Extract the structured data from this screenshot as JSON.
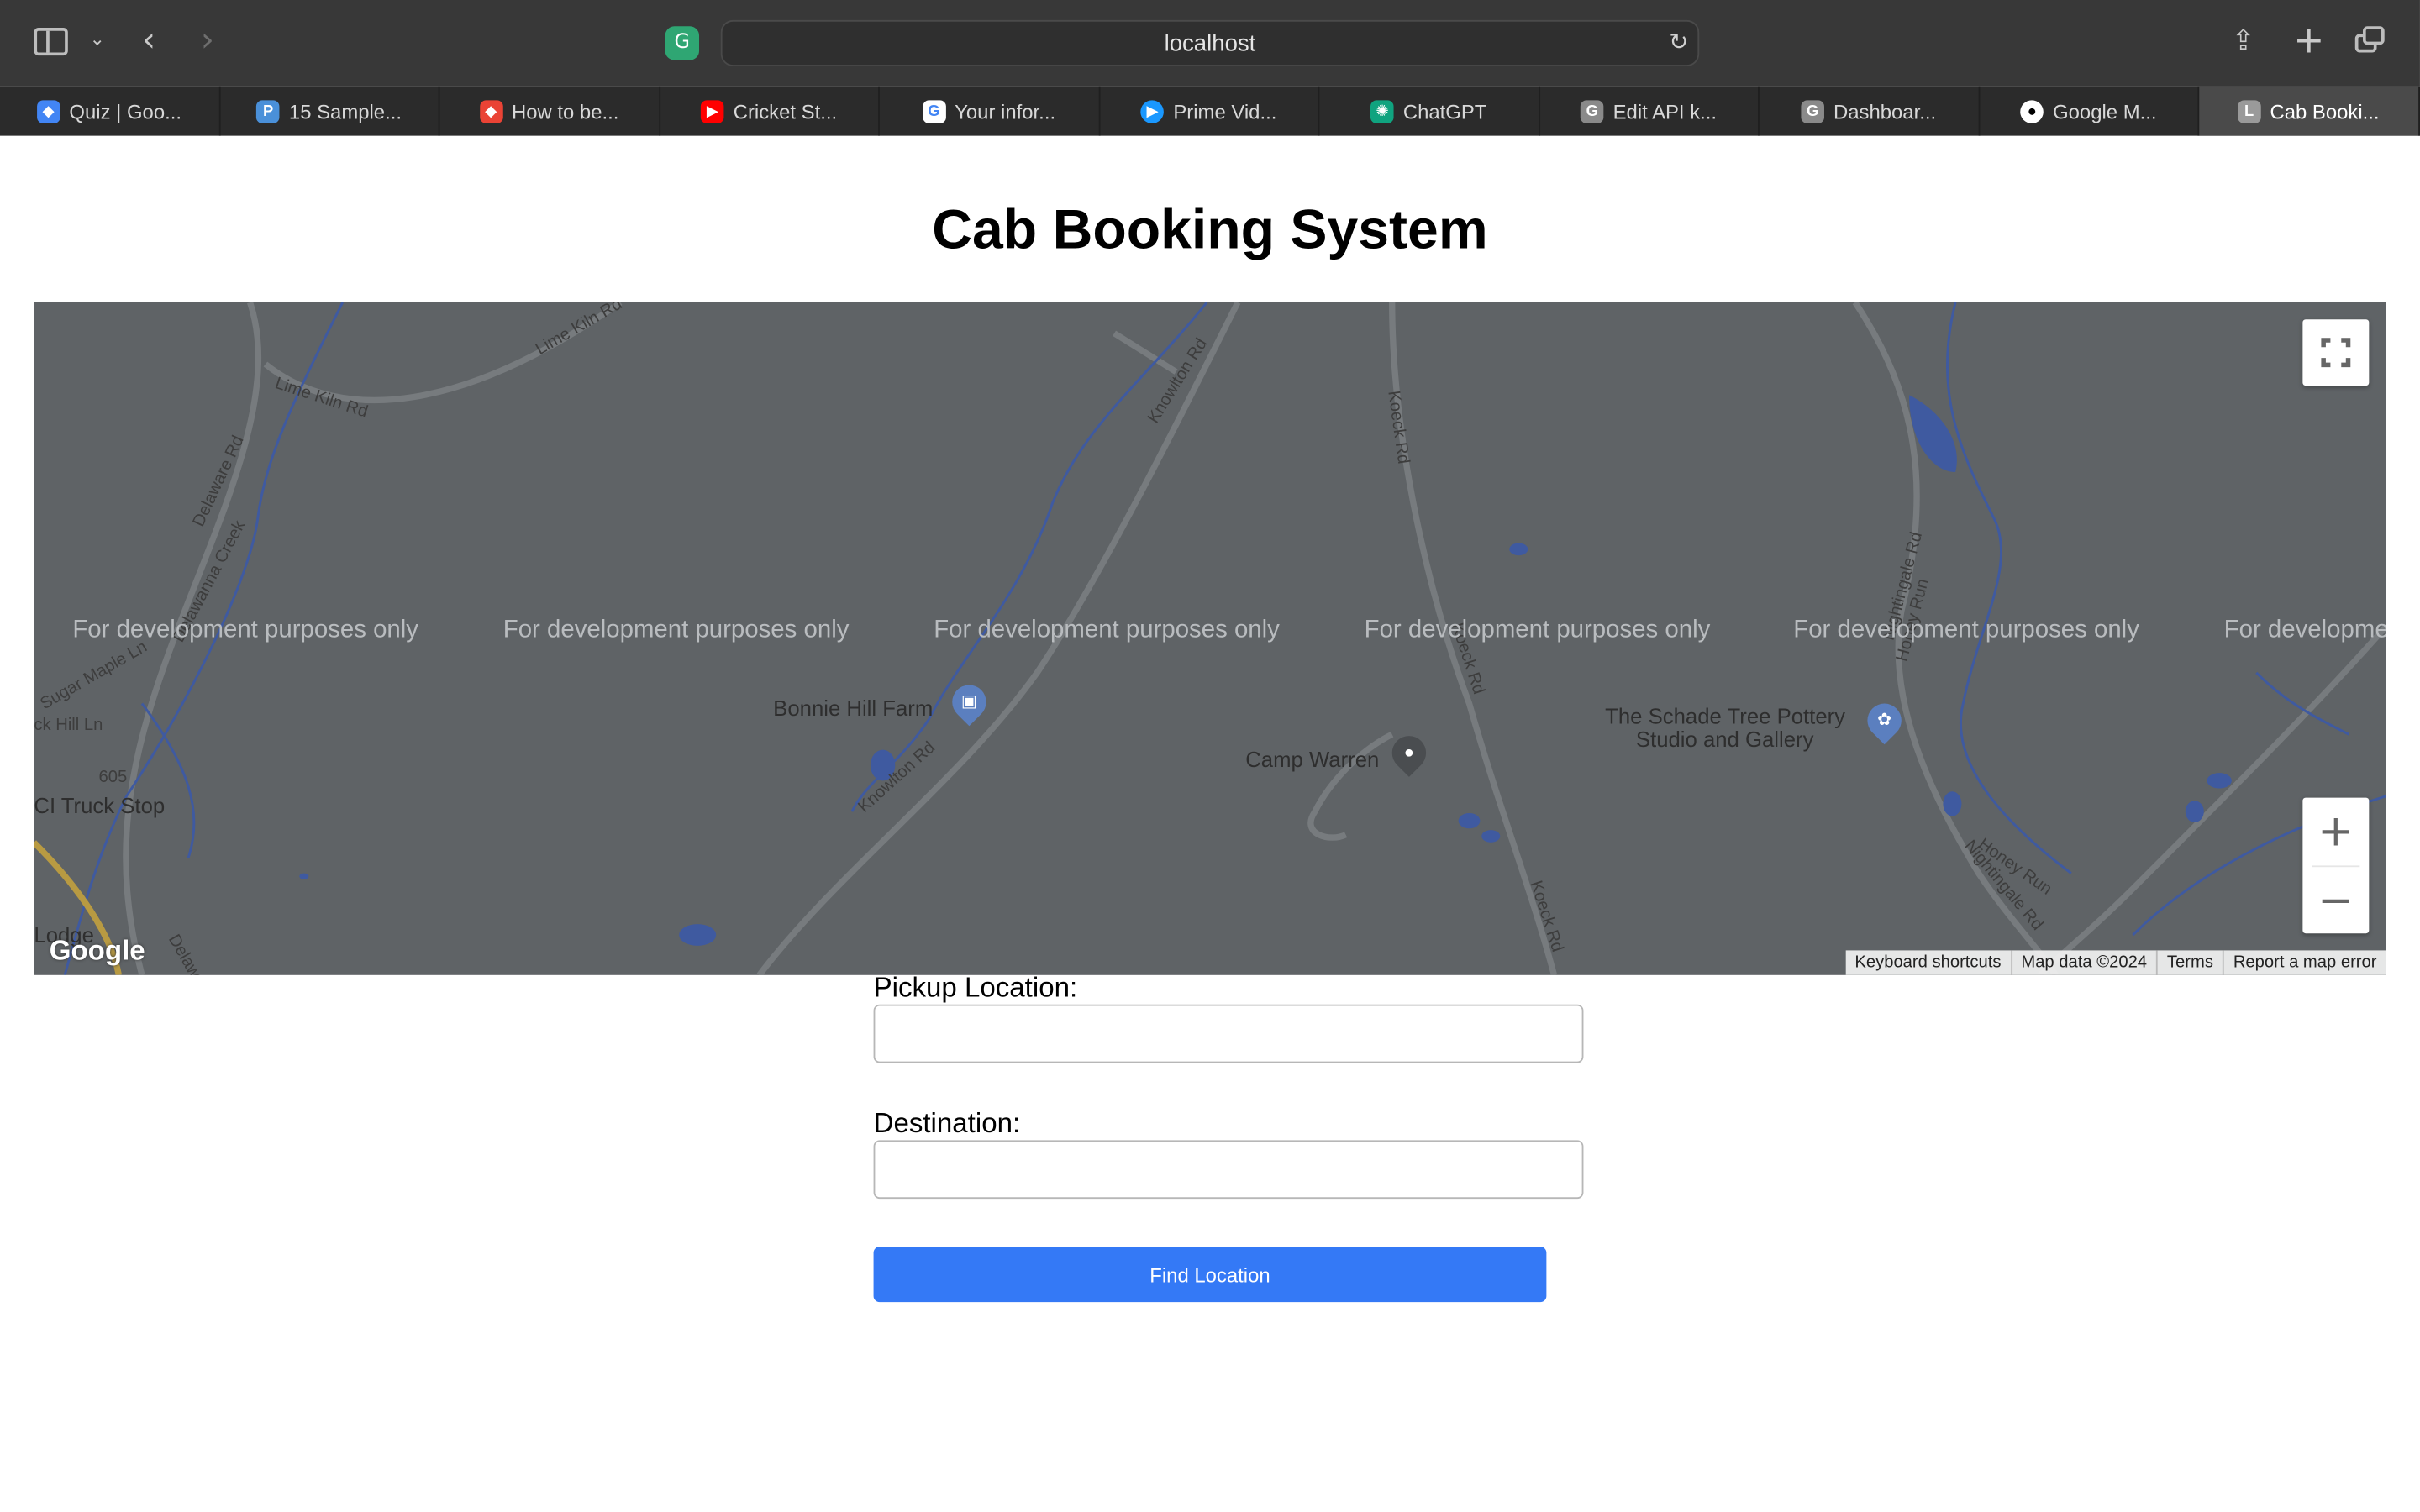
{
  "browser": {
    "address": "localhost",
    "tabs": [
      {
        "label": "Quiz | Goo...",
        "icon": "google-cloud-icon",
        "color": "#4285f4",
        "active": false
      },
      {
        "label": "15 Sample...",
        "icon": "pp-icon",
        "color": "#4a90d9",
        "active": false
      },
      {
        "label": "How to be...",
        "icon": "google-cloud-icon",
        "color": "#ea4335",
        "active": false
      },
      {
        "label": "Cricket St...",
        "icon": "youtube-icon",
        "color": "#ff0000",
        "active": false
      },
      {
        "label": "Your infor...",
        "icon": "google-icon",
        "color": "#ffffff",
        "active": false
      },
      {
        "label": "Prime Vid...",
        "icon": "prime-video-icon",
        "color": "#1a98ff",
        "active": false
      },
      {
        "label": "ChatGPT",
        "icon": "chatgpt-icon",
        "color": "#10a37f",
        "active": false
      },
      {
        "label": "Edit API k...",
        "icon": "g-letter-icon",
        "color": "#8a8a8a",
        "active": false
      },
      {
        "label": "Dashboar...",
        "icon": "g-letter-icon",
        "color": "#8a8a8a",
        "active": false
      },
      {
        "label": "Google M...",
        "icon": "github-icon",
        "color": "#ffffff",
        "active": false
      },
      {
        "label": "Cab Booki...",
        "icon": "l-letter-icon",
        "color": "#9a9a9a",
        "active": true
      }
    ]
  },
  "page": {
    "title": "Cab Booking System"
  },
  "map": {
    "watermark": "For development purposes only",
    "roads": [
      "Lime Kiln Rd",
      "Lime Kiln Rd",
      "Delaware Rd",
      "Delawanna Creek",
      "Knowlton Rd",
      "Knowlton Rd",
      "Koeck Rd",
      "Koeck Rd",
      "Koeck Rd",
      "Nightingale Rd",
      "Honey Run",
      "Honey Run",
      "Nightingale Rd",
      "Sugar Maple Ln",
      "ck Hill Ln",
      "605",
      "Delaw"
    ],
    "places": {
      "bonnie": "Bonnie Hill Farm",
      "camp": "Camp Warren",
      "schade_1": "The Schade Tree Pottery",
      "schade_2": "Studio and Gallery",
      "truck": "CI Truck Stop",
      "lodge": "Lodge"
    },
    "logo": "Google",
    "attribution": [
      "Keyboard shortcuts",
      "Map data ©2024",
      "Terms",
      "Report a map error"
    ],
    "zoom_in": "+",
    "zoom_out": "−"
  },
  "form": {
    "pickup_label": "Pickup Location:",
    "pickup_value": "",
    "destination_label": "Destination:",
    "destination_value": "",
    "submit_label": "Find Location"
  }
}
